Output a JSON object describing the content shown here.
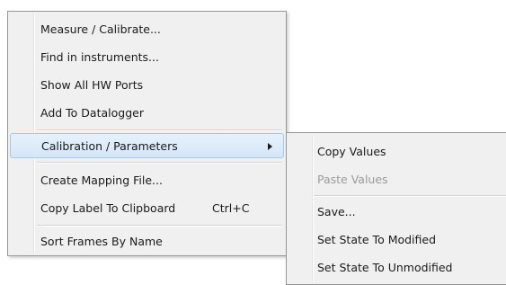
{
  "main_menu": {
    "items": [
      {
        "label": "Measure / Calibrate..."
      },
      {
        "label": "Find in instruments..."
      },
      {
        "label": "Show All HW Ports"
      },
      {
        "label": "Add To Datalogger"
      },
      {
        "label": "Calibration / Parameters",
        "highlighted": true,
        "has_submenu": true
      },
      {
        "label": "Create Mapping File..."
      },
      {
        "label": "Copy Label To Clipboard",
        "shortcut": "Ctrl+C"
      },
      {
        "label": "Sort Frames By Name"
      }
    ]
  },
  "submenu": {
    "items": [
      {
        "label": "Copy Values"
      },
      {
        "label": "Paste Values",
        "disabled": true
      },
      {
        "label": "Save..."
      },
      {
        "label": "Set State To Modified"
      },
      {
        "label": "Set State To Unmodified"
      }
    ]
  },
  "colors": {
    "menu_background": "#f0f0f0",
    "highlight_border": "#a8c8ea",
    "disabled_text": "#9a9a9a"
  }
}
